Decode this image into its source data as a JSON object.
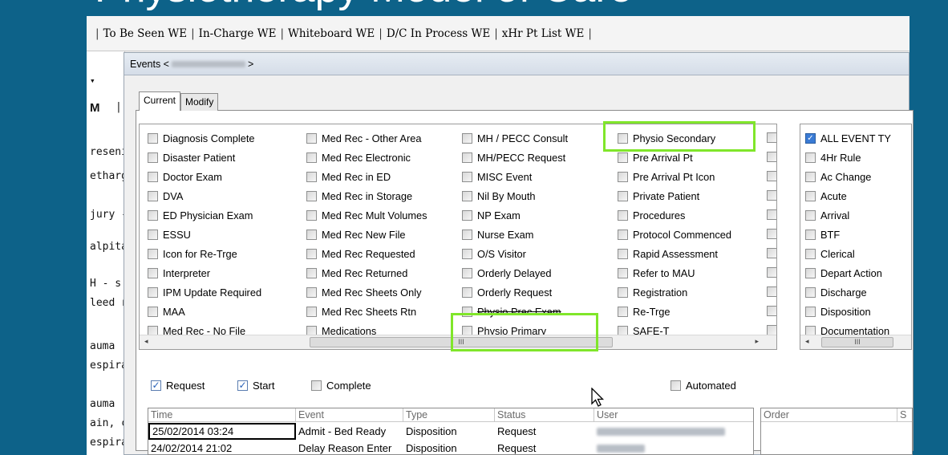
{
  "slide": {
    "title": "Physiotherapy Model of Care"
  },
  "top_tabs": [
    "To Be Seen WE",
    "In-Charge WE",
    "Whiteboard WE",
    "D/C In Process WE",
    "xHr Pt List WE"
  ],
  "left_panel": {
    "dropdown_glyph": "▾",
    "header": "M",
    "header_sep": "|",
    "rows": [
      "reseni",
      "etharg",
      "jury -",
      "alpita",
      "H - s",
      "leed r",
      "auma",
      "espira",
      "auma",
      "ain, c",
      "espira"
    ]
  },
  "dialog": {
    "title_prefix": "Events <",
    "title_suffix": ">",
    "tabs": [
      {
        "label": "Current",
        "active": true
      },
      {
        "label": "Modify",
        "active": false
      }
    ],
    "events_columns": [
      [
        "Diagnosis Complete",
        "Disaster Patient",
        "Doctor Exam",
        "DVA",
        "ED Physician Exam",
        "ESSU",
        "Icon for Re-Trge",
        "Interpreter",
        "IPM Update Required",
        "MAA",
        "Med Rec - No File"
      ],
      [
        "Med Rec - Other Area",
        "Med Rec Electronic",
        "Med Rec in ED",
        "Med Rec in Storage",
        "Med Rec Mult Volumes",
        "Med Rec New File",
        "Med Rec Requested",
        "Med Rec Returned",
        "Med Rec Sheets Only",
        "Med Rec Sheets Rtn",
        "Medications"
      ],
      [
        "MH / PECC Consult",
        "MH/PECC Request",
        "MISC Event",
        "Nil By Mouth",
        "NP Exam",
        "Nurse Exam",
        "O/S Visitor",
        "Orderly Delayed",
        "Orderly Request",
        "Physio Prac Exam",
        "Physio Primary"
      ],
      [
        "Physio Secondary",
        "Pre Arrival Pt",
        "Pre Arrival Pt Icon",
        "Private Patient",
        "Procedures",
        "Protocol Commenced",
        "Rapid Assessment",
        "Refer to MAU",
        "Registration",
        "Re-Trge",
        "SAFE-T"
      ]
    ],
    "event_types": [
      "ALL EVENT TY",
      "4Hr Rule",
      "Ac Change",
      "Acute",
      "Arrival",
      "BTF",
      "Clerical",
      "Depart Action",
      "Discharge",
      "Disposition",
      "Documentation"
    ],
    "scroll_thumb_glyph": "III",
    "scroll_left": "◂",
    "scroll_right": "▸",
    "options": {
      "request": {
        "label": "Request",
        "checked": true
      },
      "start": {
        "label": "Start",
        "checked": true
      },
      "complete": {
        "label": "Complete",
        "checked": false
      },
      "automated": {
        "label": "Automated",
        "checked": false
      }
    },
    "grid": {
      "headers": [
        "Time",
        "Event",
        "Type",
        "Status",
        "User"
      ],
      "rows": [
        [
          "25/02/2014 03:24",
          "Admit - Bed Ready",
          "Disposition",
          "Request"
        ],
        [
          "24/02/2014 21:02",
          "Delay Reason Enter",
          "Disposition",
          "Request"
        ]
      ]
    },
    "order_headers": [
      "Order",
      "S"
    ]
  },
  "colors": {
    "slide_bg": "#0d6289",
    "highlight": "#80e62a"
  }
}
